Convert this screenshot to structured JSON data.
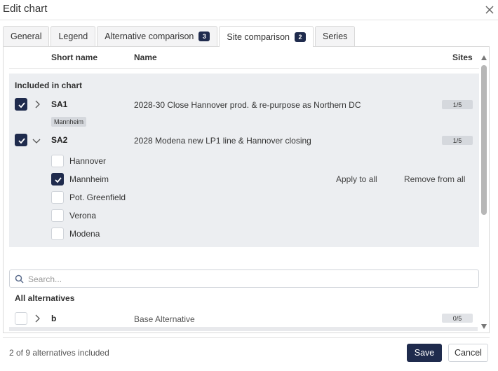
{
  "dialog": {
    "title": "Edit chart"
  },
  "tabs": [
    {
      "label": "General"
    },
    {
      "label": "Legend"
    },
    {
      "label": "Alternative comparison",
      "badge": "3"
    },
    {
      "label": "Site comparison",
      "badge": "2",
      "active": true
    },
    {
      "label": "Series"
    }
  ],
  "columns": {
    "short_name": "Short name",
    "name": "Name",
    "sites": "Sites"
  },
  "included": {
    "title": "Included in chart",
    "rows": [
      {
        "short": "SA1",
        "name": "2028-30 Close Hannover prod. & re-purpose as Northern DC",
        "sites": "1/5",
        "checked": true,
        "expanded": false,
        "tag": "Mannheim"
      },
      {
        "short": "SA2",
        "name": "2028 Modena new LP1 line & Hannover closing",
        "sites": "1/5",
        "checked": true,
        "expanded": true
      }
    ],
    "sites": [
      {
        "label": "Hannover",
        "checked": false
      },
      {
        "label": "Mannheim",
        "checked": true
      },
      {
        "label": "Pot. Greenfield",
        "checked": false
      },
      {
        "label": "Verona",
        "checked": false
      },
      {
        "label": "Modena",
        "checked": false
      }
    ],
    "apply_all": "Apply to all",
    "remove_all": "Remove from all"
  },
  "search": {
    "placeholder": "Search...",
    "value": ""
  },
  "all_alternatives": {
    "title": "All alternatives",
    "rows": [
      {
        "short": "b",
        "name": "Base Alternative",
        "sites": "0/5",
        "checked": false
      }
    ]
  },
  "footer": {
    "status": "2 of 9 alternatives included",
    "save": "Save",
    "cancel": "Cancel"
  },
  "colors": {
    "accent": "#1f2b4d",
    "included_bg": "#eceef1"
  }
}
